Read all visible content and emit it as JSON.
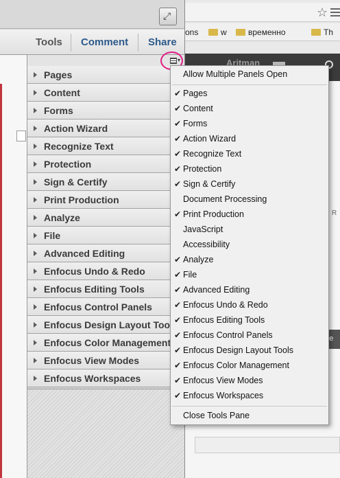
{
  "browser": {
    "star": "☆",
    "bookmarks": [
      {
        "label": "ons"
      },
      {
        "label": "w"
      },
      {
        "label": "временно"
      },
      {
        "label": "Th"
      }
    ],
    "header_text": "Aritman",
    "badge_text": "oe",
    "side_text": "R"
  },
  "acrobat": {
    "fullscreen_glyph": "⤢",
    "toolbar": {
      "tools_label": "Tools",
      "comment_label": "Comment",
      "share_label": "Share",
      "colors": {
        "tools": "#555555",
        "comment": "#2d5a8a",
        "share": "#2d5a8a"
      }
    },
    "panels": [
      "Pages",
      "Content",
      "Forms",
      "Action Wizard",
      "Recognize Text",
      "Protection",
      "Sign & Certify",
      "Print Production",
      "Analyze",
      "File",
      "Advanced Editing",
      "Enfocus Undo & Redo",
      "Enfocus Editing Tools",
      "Enfocus Control Panels",
      "Enfocus Design Layout Tools",
      "Enfocus Color Management",
      "Enfocus View Modes",
      "Enfocus Workspaces"
    ],
    "highlight_color": "#e01d86"
  },
  "menu": {
    "allow_multiple": "Allow Multiple Panels Open",
    "items": [
      {
        "label": "Pages",
        "checked": true
      },
      {
        "label": "Content",
        "checked": true
      },
      {
        "label": "Forms",
        "checked": true
      },
      {
        "label": "Action Wizard",
        "checked": true
      },
      {
        "label": "Recognize Text",
        "checked": true
      },
      {
        "label": "Protection",
        "checked": true
      },
      {
        "label": "Sign & Certify",
        "checked": true
      },
      {
        "label": "Document Processing",
        "checked": false
      },
      {
        "label": "Print Production",
        "checked": true
      },
      {
        "label": "JavaScript",
        "checked": false
      },
      {
        "label": "Accessibility",
        "checked": false
      },
      {
        "label": "Analyze",
        "checked": true
      },
      {
        "label": "File",
        "checked": true
      },
      {
        "label": "Advanced Editing",
        "checked": true
      },
      {
        "label": "Enfocus Undo & Redo",
        "checked": true
      },
      {
        "label": "Enfocus Editing Tools",
        "checked": true
      },
      {
        "label": "Enfocus Control Panels",
        "checked": true
      },
      {
        "label": "Enfocus Design Layout Tools",
        "checked": true
      },
      {
        "label": "Enfocus Color Management",
        "checked": true
      },
      {
        "label": "Enfocus View Modes",
        "checked": true
      },
      {
        "label": "Enfocus Workspaces",
        "checked": true
      }
    ],
    "close_label": "Close Tools Pane",
    "check_glyph": "✔"
  }
}
